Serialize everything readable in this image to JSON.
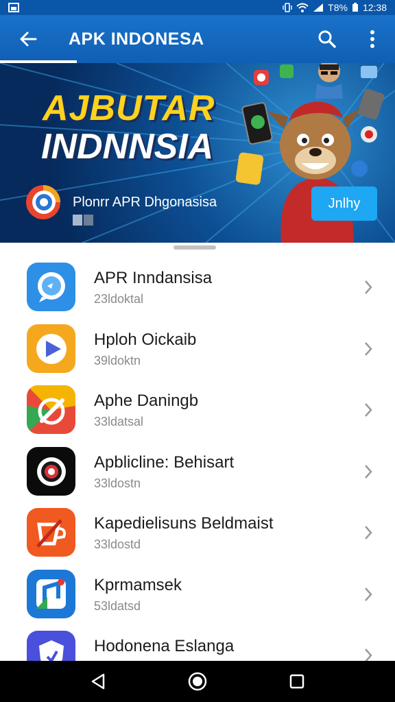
{
  "status_bar": {
    "battery_text": "T8%",
    "time": "12:38"
  },
  "app_bar": {
    "title": "APK  INDONESA",
    "back_icon": "arrow-back-icon",
    "search_icon": "search-icon",
    "menu_icon": "more-vert-icon"
  },
  "banner": {
    "title_line1": "AJBUTAR",
    "title_line2": "INDNNSIA",
    "app_name": "Plonrr APR Dhgonasisa",
    "install_label": "Jnlhy"
  },
  "apps": [
    {
      "name": "APR Inndansisa",
      "sub": "23ldoktal",
      "icon": "chat-bubble-icon"
    },
    {
      "name": "Hploh Oickaib",
      "sub": "39ldoktn",
      "icon": "play-icon"
    },
    {
      "name": "Aphe Daningb",
      "sub": "33ldatsal",
      "icon": "pen-circle-icon"
    },
    {
      "name": "Apblicline: Behisart",
      "sub": "33ldostn",
      "icon": "target-icon"
    },
    {
      "name": "Kapedielisuns Beldmaist",
      "sub": "33ldostd",
      "icon": "cup-icon"
    },
    {
      "name": "Kprmamsek",
      "sub": "53ldatsd",
      "icon": "music-note-icon"
    },
    {
      "name": "Hodonena Eslanga",
      "sub": "",
      "icon": "shield-icon"
    }
  ],
  "colors": {
    "appbar": "#1a72c8",
    "install_button": "#1ea7f2",
    "banner_yellow": "#ffd21f"
  }
}
